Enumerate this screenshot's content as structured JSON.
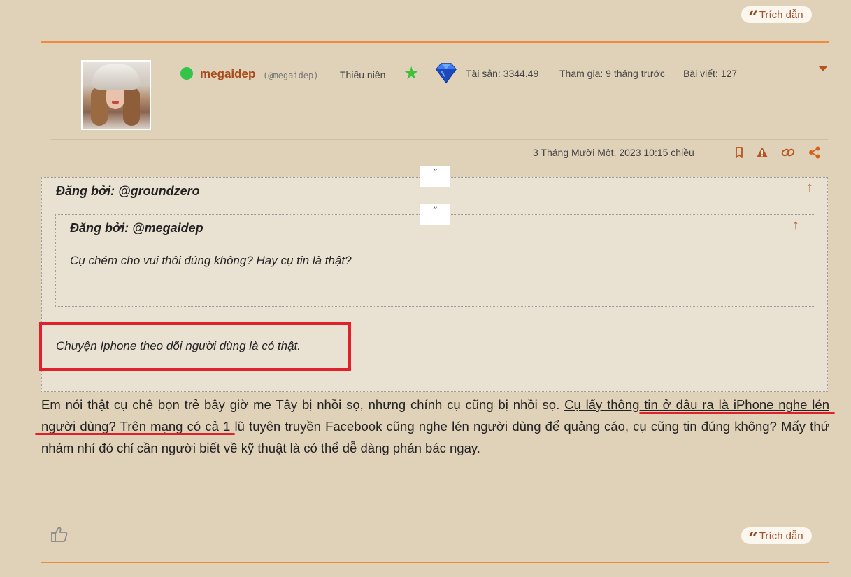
{
  "post_top": {
    "quote_button": "Trích dẫn"
  },
  "author": {
    "username": "megaidep",
    "handle": "(@megaidep)",
    "rank": "Thiếu niên",
    "assets": "Tài sản: 3344.49",
    "joined": "Tham gia: 9 tháng trước",
    "posts": "Bài viết: 127"
  },
  "post": {
    "timestamp": "3 Tháng Mười Một, 2023 10:15 chiều",
    "quote_mark": "“",
    "outer_quote": {
      "posted_by": "Đăng bởi: @groundzero",
      "text": "Chuyện Iphone theo dõi người dùng là có thật.",
      "up_arrow": "↑"
    },
    "inner_quote": {
      "posted_by": "Đăng bởi: @megaidep",
      "text": "Cụ chém cho vui thôi đúng không? Hay cụ tin là thật?",
      "up_arrow": "↑"
    },
    "body": {
      "part1": "Em nói thật cụ chê bọn trẻ bây giờ me Tây bị nhồi sọ, nhưng chính cụ cũng bị nhồi sọ. ",
      "link": "Cụ lấy thông tin ở đâu ra là iPhone nghe lén người dùng",
      "part2": "? Trên mạng có cả 1 lũ tuyên truyền Facebook cũng nghe lén người dùng để quảng cáo, cụ cũng tin đúng không? Mấy thứ nhảm nhí đó chỉ cần người biết về kỹ thuật là có thể dễ dàng phản bác ngay."
    },
    "quote_button": "Trích dẫn"
  },
  "colors": {
    "background": "#e0d2b8",
    "accent": "#ee8b3e",
    "username": "#a84a1c",
    "highlight_red": "#e0202a",
    "online": "#35c44a"
  }
}
